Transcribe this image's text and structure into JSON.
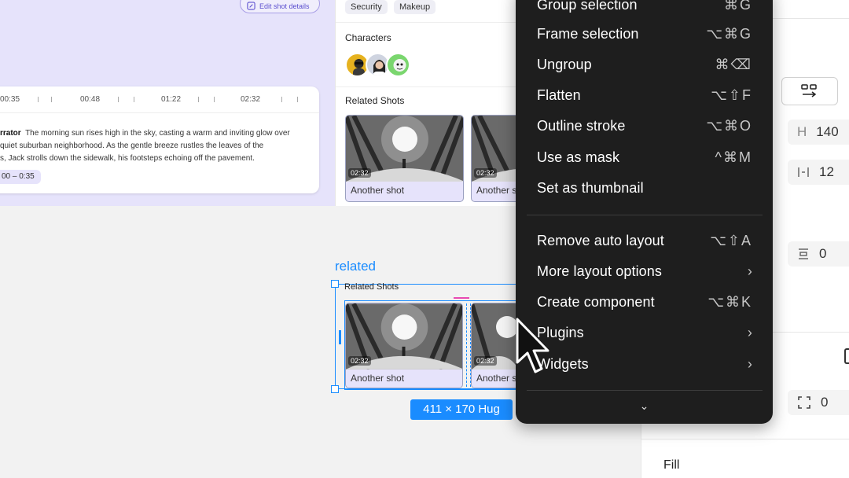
{
  "preview": {
    "edit_button_label": "Edit shot details",
    "timeline": [
      "00:35",
      "00:48",
      "01:22",
      "02:32"
    ],
    "narrator_label": "rrator",
    "narration": "The morning sun rises high in the sky, casting a warm and inviting glow over a quiet suburban neighborhood. As the gentle breeze rustles the leaves of the trees, Jack strolls down the sidewalk, his footsteps echoing off the pavement.",
    "narration_line1": "The morning sun rises high in the sky, casting a warm and inviting glow over",
    "narration_line2": "quiet suburban neighborhood. As the gentle breeze rustles the leaves of the",
    "narration_line3": "s, Jack strolls down the sidewalk, his footsteps echoing off the pavement.",
    "time_range": "00 – 0:35",
    "tags": [
      "Security",
      "Makeup"
    ],
    "characters_title": "Characters",
    "related_title": "Related Shots",
    "shots": [
      {
        "time": "02:32",
        "label": "Another shot"
      },
      {
        "time": "02:32",
        "label": "Another s"
      }
    ]
  },
  "canvas": {
    "component_label": "related",
    "related_title": "Related Shots",
    "shots": [
      {
        "time": "02:32",
        "label": "Another shot"
      },
      {
        "time": "02:32",
        "label": "Another s"
      }
    ],
    "dimension_badge": "411 × 170 Hug"
  },
  "context_menu": {
    "items": [
      {
        "label": "Group selection",
        "shortcut": "⌘G"
      },
      {
        "label": "Frame selection",
        "shortcut": "⌥⌘G"
      },
      {
        "label": "Ungroup",
        "shortcut": "⌘⌫"
      },
      {
        "label": "Flatten",
        "shortcut": "⌥⇧F"
      },
      {
        "label": "Outline stroke",
        "shortcut": "⌥⌘O"
      },
      {
        "label": "Use as mask",
        "shortcut": "^⌘M"
      },
      {
        "label": "Set as thumbnail",
        "shortcut": ""
      },
      {
        "label": "Remove auto layout",
        "shortcut": "⌥⇧A"
      },
      {
        "label": "More layout options",
        "shortcut": "›"
      },
      {
        "label": "Create component",
        "shortcut": "⌥⌘K"
      },
      {
        "label": "Plugins",
        "shortcut": "›"
      },
      {
        "label": "Widgets",
        "shortcut": "›"
      }
    ],
    "more_glyph": "⌄"
  },
  "properties": {
    "height_key": "H",
    "height_value": "140",
    "gap_value": "12",
    "padding_value": "0",
    "clip_value": "0",
    "fill_label": "Fill",
    "partial_text": "t"
  },
  "colors": {
    "accent": "#1a8cff",
    "menu_bg": "#1e1e1e",
    "preview_bg": "#e6e3fb"
  }
}
